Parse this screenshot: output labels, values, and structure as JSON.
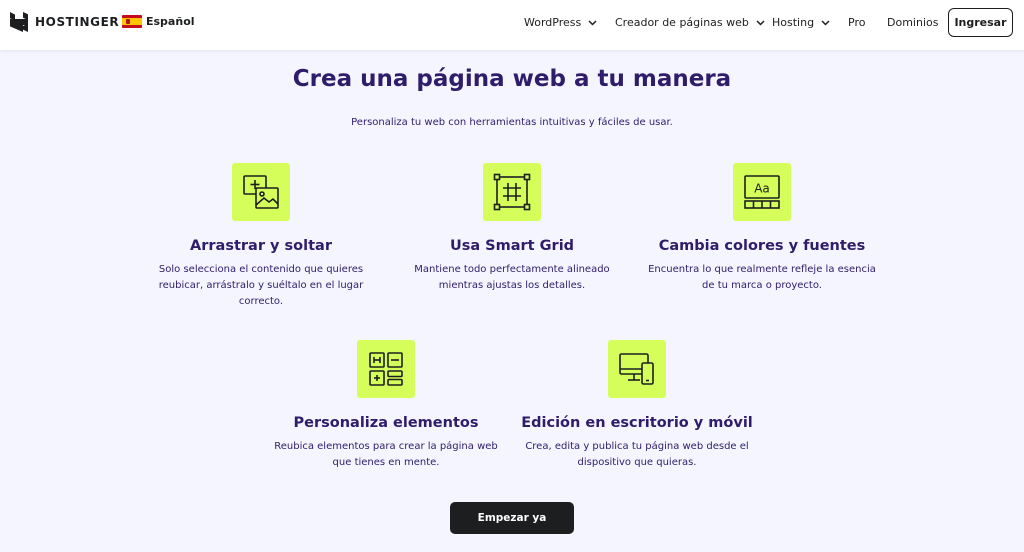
{
  "header": {
    "logo_text": "HOSTINGER",
    "language": "Español",
    "nav": [
      {
        "label": "WordPress",
        "has_dropdown": true
      },
      {
        "label": "Creador de páginas web",
        "has_dropdown": true
      },
      {
        "label": "Hosting",
        "has_dropdown": true
      },
      {
        "label": "Pro",
        "has_dropdown": false
      },
      {
        "label": "Dominios",
        "has_dropdown": false
      }
    ],
    "login_label": "Ingresar"
  },
  "main": {
    "title": "Crea una página web a tu manera",
    "subtitle": "Personaliza tu web con herramientas intuitivas y fáciles de usar.",
    "features": [
      {
        "icon": "image-add-icon",
        "title": "Arrastrar y soltar",
        "text": "Solo selecciona el contenido que quieres reubicar, arrástralo y suéltalo en el lugar correcto."
      },
      {
        "icon": "grid-icon",
        "title": "Usa Smart Grid",
        "text": "Mantiene todo perfectamente alineado mientras ajustas los detalles."
      },
      {
        "icon": "typography-palette-icon",
        "title": "Cambia colores y fuentes",
        "text": "Encuentra lo que realmente refleje la esencia de tu marca o proyecto."
      },
      {
        "icon": "layout-elements-icon",
        "title": "Personaliza elementos",
        "text": "Reubica elementos para crear la página web que tienes en mente."
      },
      {
        "icon": "desktop-mobile-icon",
        "title": "Edición en escritorio y móvil",
        "text": "Crea, edita y publica tu página web desde el dispositivo que quieras."
      }
    ],
    "cta_label": "Empezar ya",
    "icon_text_aa": "Aa"
  },
  "colors": {
    "accent": "#d5fe5b",
    "text": "#2f1c6a",
    "background": "#f4f5ff",
    "dark": "#1d1e20"
  }
}
